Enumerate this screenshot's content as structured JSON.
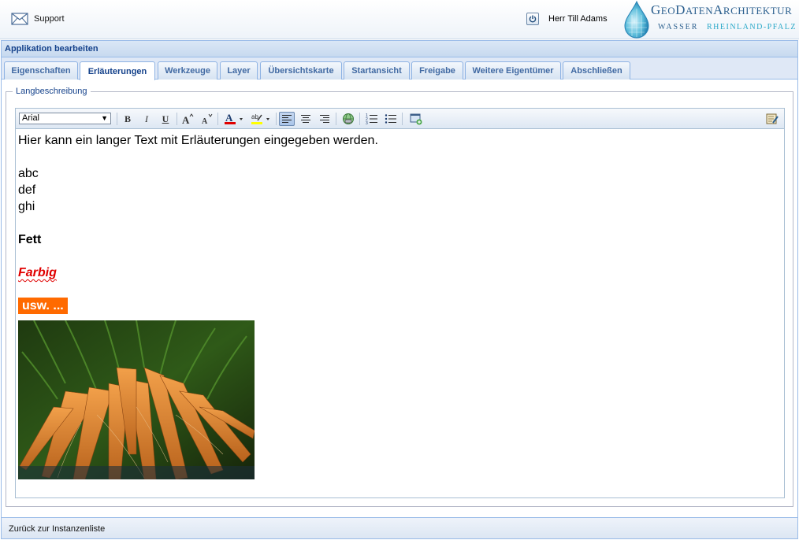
{
  "header": {
    "support_label": "Support",
    "user_name": "Herr Till Adams",
    "logo": {
      "line1_a": "G",
      "line1_b": "EO",
      "line1_c": "D",
      "line1_d": "ATEN",
      "line1_e": "A",
      "line1_f": "RCHITEKTUR",
      "line2_a": "WASSER",
      "line2_b": "RHEINLAND-PFALZ"
    }
  },
  "panel": {
    "title": "Applikation bearbeiten",
    "tabs": [
      {
        "label": "Eigenschaften"
      },
      {
        "label": "Erläuterungen",
        "active": true
      },
      {
        "label": "Werkzeuge"
      },
      {
        "label": "Layer"
      },
      {
        "label": "Übersichtskarte"
      },
      {
        "label": "Startansicht"
      },
      {
        "label": "Freigabe"
      },
      {
        "label": "Weitere Eigentümer"
      },
      {
        "label": "Abschließen"
      }
    ]
  },
  "fieldset": {
    "legend": "Langbeschreibung"
  },
  "editor": {
    "font": "Arial",
    "lines": [
      "Hier kann ein langer Text mit Erläuterungen eingegeben werden.",
      "abc",
      "def",
      "ghi"
    ],
    "bold_text": "Fett",
    "colored_text": "Farbig",
    "highlight_text": "usw. ...",
    "colors": {
      "font_color": "#e00000",
      "highlight_color": "#ff6a00",
      "highlighter_bar": "#ffff00"
    }
  },
  "footer": {
    "back_label": "Zurück zur Instanzenliste"
  }
}
